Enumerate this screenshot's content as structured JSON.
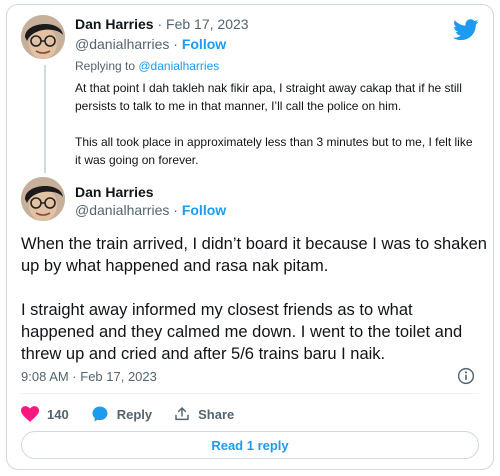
{
  "reply_tweet": {
    "author_name": "Dan Harries",
    "separator": " · ",
    "date": "Feb 17, 2023",
    "handle": "@danialharries",
    "dot": " · ",
    "follow_label": "Follow",
    "replying_prefix": "Replying to ",
    "replying_handle": "@danialharries",
    "paragraph_1": "At that point I dah takleh nak fikir apa, I straight away cakap that if he still persists to talk to me in that manner, I’ll call the police on him.",
    "paragraph_2": "This all took place in approximately less than 3 minutes but to me, I felt like it was going on forever."
  },
  "main_tweet": {
    "author_name": "Dan Harries",
    "handle": "@danialharries",
    "dot": " · ",
    "follow_label": "Follow",
    "paragraph_1": "When the train arrived, I didn’t board it because I was to shaken up by what happened and rasa nak pitam.",
    "paragraph_2": "I straight away informed my closest friends as to what happened and they calmed me down. I went to the toilet and threw up and cried and after 5/6 trains baru I naik.",
    "timestamp": "9:08 AM · Feb 17, 2023",
    "like_count": "140",
    "reply_label": "Reply",
    "share_label": "Share",
    "read_replies_label": "Read 1 reply"
  },
  "icons": {
    "logo": "twitter-bird-icon",
    "info": "info-icon",
    "like": "heart-icon",
    "reply": "speech-bubble-icon",
    "share": "share-icon"
  },
  "colors": {
    "accent": "#1d9bf0",
    "like": "#f91880",
    "muted": "#536471",
    "border": "#cfd9de"
  }
}
